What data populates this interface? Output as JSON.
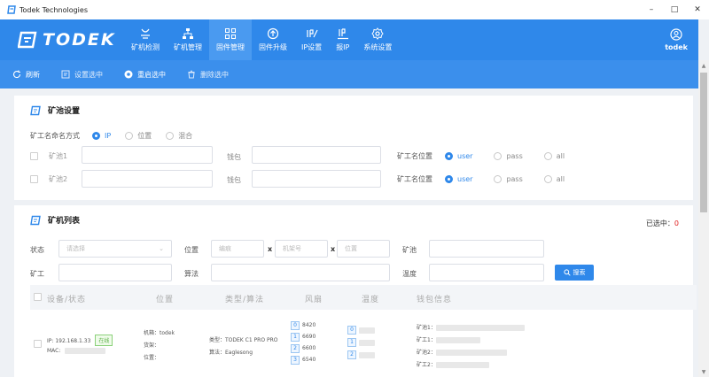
{
  "window": {
    "title": "Todek Technologies",
    "controls": [
      "–",
      "□",
      "✕"
    ]
  },
  "brand": {
    "logo_text": "TODEK",
    "accent": "#2f88ea"
  },
  "nav": [
    {
      "label": "矿机检测",
      "icon": "monitor-check-icon"
    },
    {
      "label": "矿机管理",
      "icon": "network-tree-icon"
    },
    {
      "label": "固件管理",
      "icon": "grid-apps-icon",
      "active": true
    },
    {
      "label": "固件升级",
      "icon": "upload-circle-icon"
    },
    {
      "label": "IP设置",
      "icon": "ip-edit-icon"
    },
    {
      "label": "报IP",
      "icon": "ip-report-icon"
    },
    {
      "label": "系统设置",
      "icon": "gear-icon"
    }
  ],
  "user": {
    "name": "todek",
    "icon": "user-circle-icon"
  },
  "toolbar": {
    "refresh": "刷新",
    "set_selected": "设置选中",
    "restart_selected": "重启选中",
    "delete_selected": "删除选中"
  },
  "pool_settings": {
    "title": "矿池设置",
    "naming_label": "矿工名命名方式",
    "naming_options": [
      "IP",
      "位置",
      "混合"
    ],
    "naming_selected": "IP",
    "pools": [
      {
        "label": "矿池1",
        "wallet_label": "钱包",
        "pos_label": "矿工名位置",
        "options": [
          "user",
          "pass",
          "all"
        ],
        "selected": "user"
      },
      {
        "label": "矿池2",
        "wallet_label": "钱包",
        "pos_label": "矿工名位置",
        "options": [
          "user",
          "pass",
          "all"
        ],
        "selected": "user"
      }
    ]
  },
  "miner_list": {
    "title": "矿机列表",
    "selected_label": "已选中：",
    "selected_count": "0",
    "filters": {
      "status_label": "状态",
      "status_placeholder": "请选择",
      "location_label": "位置",
      "location_ph1": "编痕",
      "location_ph2": "机架号",
      "location_ph3": "位置",
      "x_sep": "x",
      "pool_label": "矿池",
      "worker_label": "矿工",
      "algo_label": "算法",
      "temp_label": "温度",
      "search_button": "搜索"
    },
    "columns": [
      "设备/状态",
      "位置",
      "类型/算法",
      "风扇",
      "温度",
      "钱包信息"
    ],
    "rows": [
      {
        "ip": "IP: 192.168.1.33",
        "status": "在线",
        "mac_label": "MAC:",
        "loc_lines": [
          "机箱：todek",
          "货架：",
          "位置："
        ],
        "type": "类型：TODEK C1 PRO PRO",
        "algo": "算法：Eaglesong",
        "fans": [
          {
            "idx": "0",
            "rpm": "8420"
          },
          {
            "idx": "1",
            "rpm": "6690"
          },
          {
            "idx": "2",
            "rpm": "6600"
          },
          {
            "idx": "3",
            "rpm": "6540"
          }
        ],
        "temps": [
          "0",
          "1",
          "2"
        ],
        "wallet_lines": [
          "矿池1：",
          "矿工1：",
          "矿池2：",
          "矿工2："
        ]
      }
    ]
  }
}
